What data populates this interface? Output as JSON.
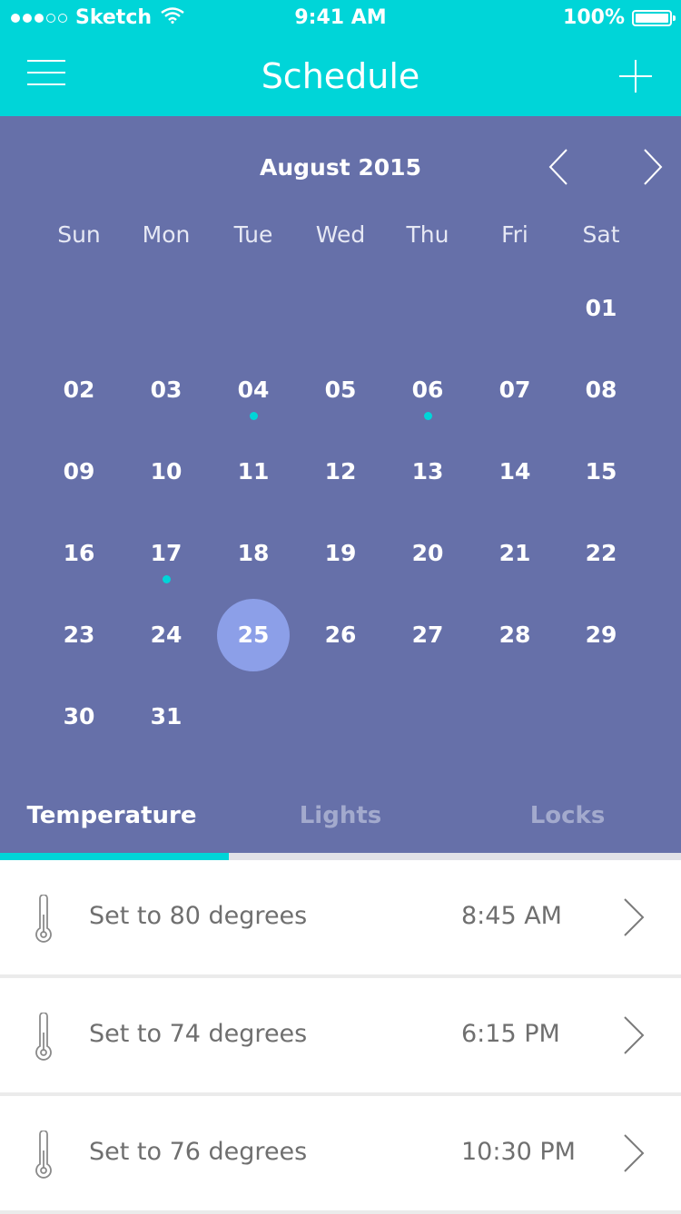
{
  "status_bar": {
    "carrier": "Sketch",
    "time": "9:41 AM",
    "battery": "100%"
  },
  "nav": {
    "title": "Schedule",
    "menu_icon": "hamburger-menu-icon",
    "add_icon": "plus-icon"
  },
  "calendar": {
    "month": "August 2015",
    "weekdays": [
      "Sun",
      "Mon",
      "Tue",
      "Wed",
      "Thu",
      "Fri",
      "Sat"
    ],
    "days": [
      "01",
      "02",
      "03",
      "04",
      "05",
      "06",
      "07",
      "08",
      "09",
      "10",
      "11",
      "12",
      "13",
      "14",
      "15",
      "16",
      "17",
      "18",
      "19",
      "20",
      "21",
      "22",
      "23",
      "24",
      "25",
      "26",
      "27",
      "28",
      "29",
      "30",
      "31"
    ],
    "first_weekday_index": 6,
    "selected_day": "25",
    "event_days": [
      "04",
      "06",
      "17"
    ]
  },
  "tabs": [
    {
      "label": "Temperature",
      "active": true
    },
    {
      "label": "Lights",
      "active": false
    },
    {
      "label": "Locks",
      "active": false
    }
  ],
  "schedule_items": [
    {
      "title": "Set to 80 degrees",
      "time": "8:45 AM",
      "icon": "thermometer-icon"
    },
    {
      "title": "Set to 74 degrees",
      "time": "6:15 PM",
      "icon": "thermometer-icon"
    },
    {
      "title": "Set to 76 degrees",
      "time": "10:30 PM",
      "icon": "thermometer-icon"
    }
  ],
  "colors": {
    "accent": "#00d5d8",
    "calendar_bg": "#6670a9",
    "selected_day": "#8c9fe8",
    "item_text": "#6f6f6f"
  }
}
